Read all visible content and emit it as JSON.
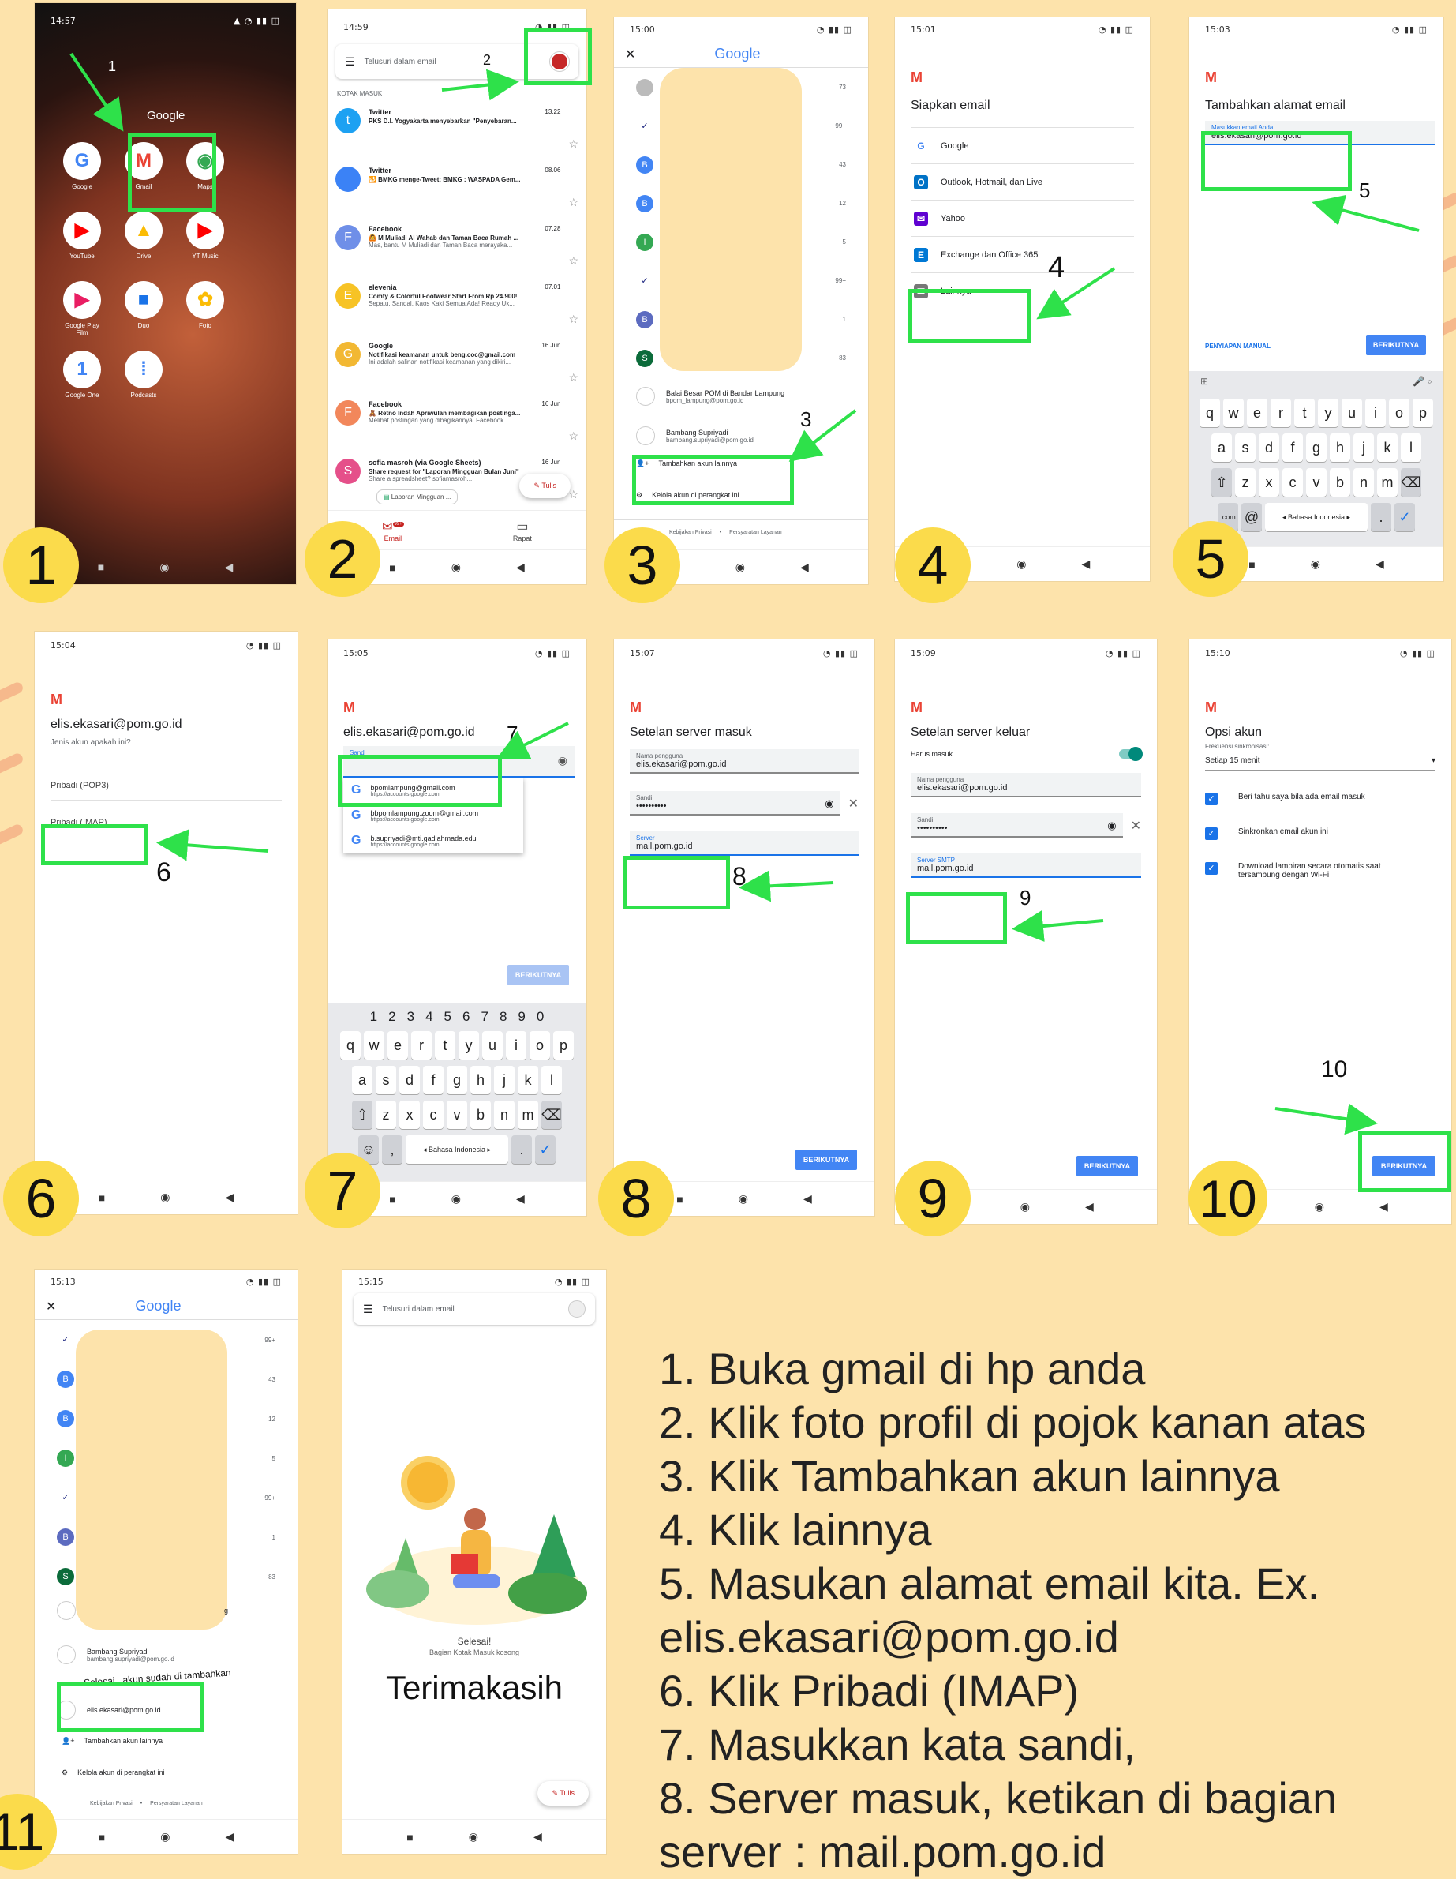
{
  "steps": [
    "1. Buka gmail di hp anda",
    "2. Klik foto profil di pojok kanan atas",
    "3. Klik Tambahkan akun lainnya",
    "4. Klik lainnya",
    "5. Masukan alamat email kita. Ex.",
    "    elis.ekasari@pom.go.id",
    "6. Klik Pribadi (IMAP)",
    "7. Masukkan kata sandi,",
    "8. Server masuk, ketikan di bagian",
    "    server : mail.pom.go.id"
  ],
  "badges": [
    "1",
    "2",
    "3",
    "4",
    "5",
    "6",
    "7",
    "8",
    "9",
    "10",
    "11"
  ],
  "markers": [
    "1",
    "2",
    "3",
    "4",
    "5",
    "6",
    "7",
    "8",
    "9",
    "10"
  ],
  "s1": {
    "time": "14:57",
    "home_title": "Google",
    "apps": [
      {
        "label": "Google",
        "glyph": "G",
        "color": "#4285f4"
      },
      {
        "label": "Gmail",
        "glyph": "M",
        "color": "#ea4335"
      },
      {
        "label": "Maps",
        "glyph": "◉",
        "color": "#34a853"
      },
      {
        "label": "YouTube",
        "glyph": "▶",
        "color": "#ff0000"
      },
      {
        "label": "Drive",
        "glyph": "▲",
        "color": "#fbbc05"
      },
      {
        "label": "YT Music",
        "glyph": "▶",
        "color": "#ff0000"
      },
      {
        "label": "Google Play Film",
        "glyph": "▶",
        "color": "#e91e63"
      },
      {
        "label": "Duo",
        "glyph": "■",
        "color": "#1a73e8"
      },
      {
        "label": "Foto",
        "glyph": "✿",
        "color": "#fbbc05"
      },
      {
        "label": "Google One",
        "glyph": "1",
        "color": "#4285f4"
      },
      {
        "label": "Podcasts",
        "glyph": "⁞",
        "color": "#4285f4"
      }
    ]
  },
  "s2": {
    "time": "14:59",
    "search": "Telusuri dalam email",
    "section": "KOTAK MASUK",
    "compose": "Tulis",
    "tab_mail": "Email",
    "tab_meet": "Rapat",
    "mail_count": "99+",
    "chip": "Laporan Mingguan ...",
    "items": [
      {
        "from": "Twitter",
        "date": "13.22",
        "subject": "PKS D.I. Yogyakarta menyebarkan \"Penyebaran...",
        "snippet": "",
        "color": "#1da1f2",
        "initial": "t"
      },
      {
        "from": "Twitter",
        "date": "08.06",
        "subject": "🔁 BMKG menge-Tweet: BMKG : WASPADA Gem...",
        "snippet": "",
        "color": "#3b82f6",
        "initial": ""
      },
      {
        "from": "Facebook",
        "date": "07.28",
        "subject": "🙆 M Muliadi Al Wahab dan Taman Baca Rumah ...",
        "snippet": "Mas, bantu M Muliadi dan Taman Baca merayaka...",
        "color": "#6f8fe8",
        "initial": "F"
      },
      {
        "from": "elevenia",
        "date": "07.01",
        "subject": "Comfy & Colorful Footwear Start From Rp 24.900!",
        "snippet": "Sepatu, Sandal, Kaos Kaki Semua Ada! Ready Uk...",
        "color": "#f7c325",
        "initial": "E"
      },
      {
        "from": "Google",
        "date": "16 Jun",
        "subject": "Notifikasi keamanan untuk beng.coc@gmail.com",
        "snippet": "Ini adalah salinan notifikasi keamanan yang dikiri...",
        "color": "#f2b833",
        "initial": "G"
      },
      {
        "from": "Facebook",
        "date": "16 Jun",
        "subject": "🧸 Retno Indah Apriwulan membagikan postinga...",
        "snippet": "Melihat postingan yang dibagikannya. Facebook ...",
        "color": "#f2875b",
        "initial": "F"
      },
      {
        "from": "sofia masroh (via Google Sheets)",
        "date": "16 Jun",
        "subject": "Share request for \"Laporan Mingguan Bulan Juni\"",
        "snippet": "Share a spreadsheet? sofiamasroh...",
        "color": "#e5508a",
        "initial": "S"
      }
    ]
  },
  "s3": {
    "time": "15:00",
    "brand": "Google",
    "accounts_counts": [
      "73",
      "99+",
      "43",
      "12",
      "5",
      "99+",
      "1",
      "83"
    ],
    "acc1_name": "Balai Besar POM di Bandar Lampung",
    "acc1_mail": "bpom_lampung@pom.go.id",
    "acc2_name": "Bambang Supriyadi",
    "acc2_mail": "bambang.supriyadi@pom.go.id",
    "add": "Tambahkan akun lainnya",
    "manage": "Kelola akun di perangkat ini",
    "privacy": "Kebijakan Privasi",
    "terms": "Persyaratan Layanan"
  },
  "s4": {
    "time": "15:01",
    "title": "Siapkan email",
    "providers": [
      "Google",
      "Outlook, Hotmail, dan Live",
      "Yahoo",
      "Exchange dan Office 365",
      "Lainnya"
    ]
  },
  "s5": {
    "time": "15:03",
    "title": "Tambahkan alamat email",
    "label": "Masukkan email Anda",
    "value": "elis.ekasari@pom.go.id",
    "manual": "PENYIAPAN MANUAL",
    "next": "BERIKUTNYA",
    "lang": "◂ Bahasa Indonesia ▸"
  },
  "s6": {
    "time": "15:04",
    "email": "elis.ekasari@pom.go.id",
    "sub": "Jenis akun apakah ini?",
    "opt1": "Pribadi (POP3)",
    "opt2": "Pribadi (IMAP)"
  },
  "s7": {
    "time": "15:05",
    "email": "elis.ekasari@pom.go.id",
    "label": "Sandi",
    "suggest": [
      {
        "m": "bpomlampung@gmail.com",
        "u": "https://accounts.google.com"
      },
      {
        "m": "bbpomlampung.zoom@gmail.com",
        "u": "https://accounts.google.com"
      },
      {
        "m": "b.supriyadi@mti.gadjahmada.edu",
        "u": "https://accounts.google.com"
      }
    ],
    "next": "BERIKUTNYA",
    "lang": "◂ Bahasa Indonesia ▸"
  },
  "s8": {
    "time": "15:07",
    "title": "Setelan server masuk",
    "user_label": "Nama pengguna",
    "user": "elis.ekasari@pom.go.id",
    "pw_label": "Sandi",
    "pw": "••••••••••",
    "server_label": "Server",
    "server": "mail.pom.go.id",
    "next": "BERIKUTNYA"
  },
  "s9": {
    "time": "15:09",
    "title": "Setelan server keluar",
    "login": "Harus masuk",
    "user_label": "Nama pengguna",
    "user": "elis.ekasari@pom.go.id",
    "pw_label": "Sandi",
    "pw": "••••••••••",
    "server_label": "Server SMTP",
    "server": "mail.pom.go.id",
    "next": "BERIKUTNYA"
  },
  "s10": {
    "time": "15:10",
    "title": "Opsi akun",
    "freq_label": "Frekuensi sinkronisasi:",
    "freq": "Setiap 15 menit",
    "c1": "Beri tahu saya bila ada email masuk",
    "c2": "Sinkronkan email akun ini",
    "c3": "Download lampiran secara otomatis saat tersambung dengan Wi-Fi",
    "next": "BERIKUTNYA"
  },
  "s11": {
    "time": "15:13",
    "brand": "Google",
    "counts": [
      "99+",
      "43",
      "12",
      "5",
      "99+",
      "1",
      "83"
    ],
    "acc2_name": "Bambang Supriyadi",
    "acc2_mail": "bambang.supriyadi@pom.go.id",
    "toast": "Selesai.. akun sudah di tambahkan",
    "new_mail": "elis.ekasari@pom.go.id",
    "add": "Tambahkan akun lainnya",
    "manage": "Kelola akun di perangkat ini",
    "privacy": "Kebijakan Privasi",
    "terms": "Persyaratan Layanan",
    "partial": "g"
  },
  "s12": {
    "time": "15:15",
    "search": "Telusuri dalam email",
    "done": "Selesai!",
    "empty": "Bagian Kotak Masuk kosong",
    "thanks": "Terimakasih",
    "compose": "Tulis"
  },
  "colors": {
    "background": "#fde3ab",
    "highlight": "#2ee14a",
    "badge": "#fbdb4b",
    "button": "#4285f4"
  }
}
